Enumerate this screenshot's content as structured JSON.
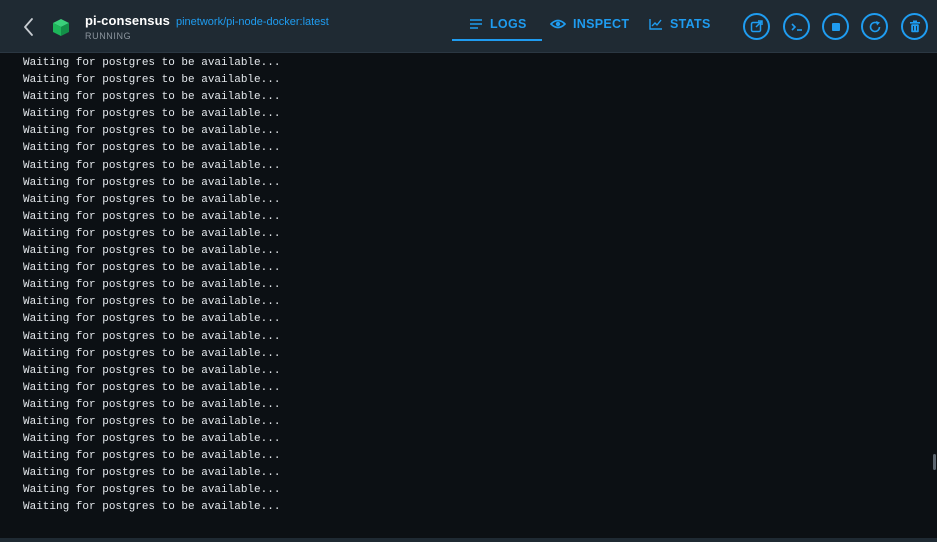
{
  "header": {
    "container_name": "pi-consensus",
    "image_name": "pinetwork/pi-node-docker:latest",
    "status": "RUNNING",
    "back_icon": "chevron-left-icon",
    "container_icon": "container-cube-icon"
  },
  "tabs": [
    {
      "label": "LOGS",
      "icon": "logs-icon",
      "active": true
    },
    {
      "label": "INSPECT",
      "icon": "eye-icon",
      "active": false
    },
    {
      "label": "STATS",
      "icon": "chart-icon",
      "active": false
    }
  ],
  "actions": [
    {
      "name": "open-in-browser",
      "icon": "external-link-icon"
    },
    {
      "name": "cli",
      "icon": "terminal-icon"
    },
    {
      "name": "stop",
      "icon": "stop-icon"
    },
    {
      "name": "restart",
      "icon": "restart-icon"
    },
    {
      "name": "delete",
      "icon": "trash-icon"
    }
  ],
  "logs": [
    "Waiting for postgres to be available...",
    "Waiting for postgres to be available...",
    "Waiting for postgres to be available...",
    "Waiting for postgres to be available...",
    "Waiting for postgres to be available...",
    "Waiting for postgres to be available...",
    "Waiting for postgres to be available...",
    "Waiting for postgres to be available...",
    "Waiting for postgres to be available...",
    "Waiting for postgres to be available...",
    "Waiting for postgres to be available...",
    "Waiting for postgres to be available...",
    "Waiting for postgres to be available...",
    "Waiting for postgres to be available...",
    "Waiting for postgres to be available...",
    "Waiting for postgres to be available...",
    "Waiting for postgres to be available...",
    "Waiting for postgres to be available...",
    "Waiting for postgres to be available...",
    "Waiting for postgres to be available...",
    "Waiting for postgres to be available...",
    "Waiting for postgres to be available...",
    "Waiting for postgres to be available...",
    "Waiting for postgres to be available...",
    "Waiting for postgres to be available...",
    "Waiting for postgres to be available...",
    "Waiting for postgres to be available..."
  ],
  "colors": {
    "accent": "#1f9cf0",
    "header_bg": "#1f2a33",
    "log_bg": "#0c1014",
    "running_green": "#1db65a"
  }
}
